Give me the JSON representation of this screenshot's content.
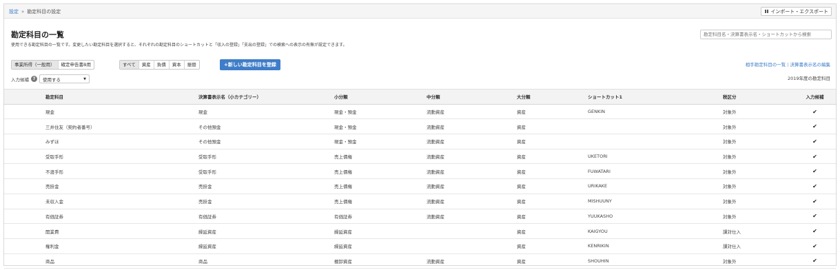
{
  "breadcrumb": {
    "root": "設定",
    "separator": "»",
    "current": "勘定科目の設定"
  },
  "import_export_label": "インポート・エクスポート",
  "page_title": "勘定科目の一覧",
  "description": "使用できる勘定科目の一覧です。変更したい勘定科目を選択すると、それぞれの勘定科目のショートカットと「収入の登録」「支出の登録」での検索への表示の有無が設定できます。",
  "search_placeholder": "勘定科目名・決算書表示名・ショートカットから検索",
  "business_type_tabs": [
    "事業所得（一般用）",
    "確定申告書B用"
  ],
  "category_tabs": [
    "すべて",
    "資産",
    "負債",
    "資本",
    "振替"
  ],
  "new_button_label": "+新しい勘定科目を登録",
  "links": {
    "counterpart": "相手勘定科目の一覧",
    "separator": "|",
    "edit_display": "決算書表示名の編集"
  },
  "filter": {
    "label": "入力候補",
    "help_icon": "?",
    "select_value": "使用する"
  },
  "year_label": "2019年度の勘定科目",
  "table": {
    "headers": [
      "勘定科目",
      "決算書表示名（小カテゴリー）",
      "小分類",
      "中分類",
      "大分類",
      "ショートカット1",
      "税区分",
      "入力候補"
    ],
    "rows": [
      [
        "現金",
        "現金",
        "現金・預金",
        "流動資産",
        "資産",
        "GENKIN",
        "対象外",
        "✔"
      ],
      [
        "三井住友（契約者番号）",
        "その他預金",
        "現金・預金",
        "流動資産",
        "資産",
        "",
        "対象外",
        "✔"
      ],
      [
        "みずほ",
        "その他預金",
        "現金・預金",
        "流動資産",
        "資産",
        "",
        "対象外",
        "✔"
      ],
      [
        "受取手形",
        "受取手形",
        "売上債権",
        "流動資産",
        "資産",
        "UKETORI",
        "対象外",
        "✔"
      ],
      [
        "不渡手形",
        "受取手形",
        "売上債権",
        "流動資産",
        "資産",
        "FUWATARI",
        "対象外",
        "✔"
      ],
      [
        "売掛金",
        "売掛金",
        "売上債権",
        "流動資産",
        "資産",
        "URIKAKE",
        "対象外",
        "✔"
      ],
      [
        "未収入金",
        "売掛金",
        "売上債権",
        "流動資産",
        "資産",
        "MISHUUNY",
        "対象外",
        "✔"
      ],
      [
        "有価証券",
        "有価証券",
        "有価証券",
        "流動資産",
        "資産",
        "YUUKASHO",
        "対象外",
        "✔"
      ],
      [
        "開業費",
        "繰延資産",
        "繰延資産",
        "",
        "資産",
        "KAIGYOU",
        "課対仕入",
        "✔"
      ],
      [
        "権利金",
        "繰延資産",
        "繰延資産",
        "",
        "資産",
        "KENRIKIN",
        "課対仕入",
        "✔"
      ],
      [
        "商品",
        "商品",
        "棚卸資産",
        "流動資産",
        "資産",
        "SHOUHIN",
        "対象外",
        "✔"
      ]
    ]
  },
  "colors": {
    "primary_button": "#3f7dc8",
    "link": "#3a7bc8",
    "header_bg": "#f3f3f3"
  }
}
